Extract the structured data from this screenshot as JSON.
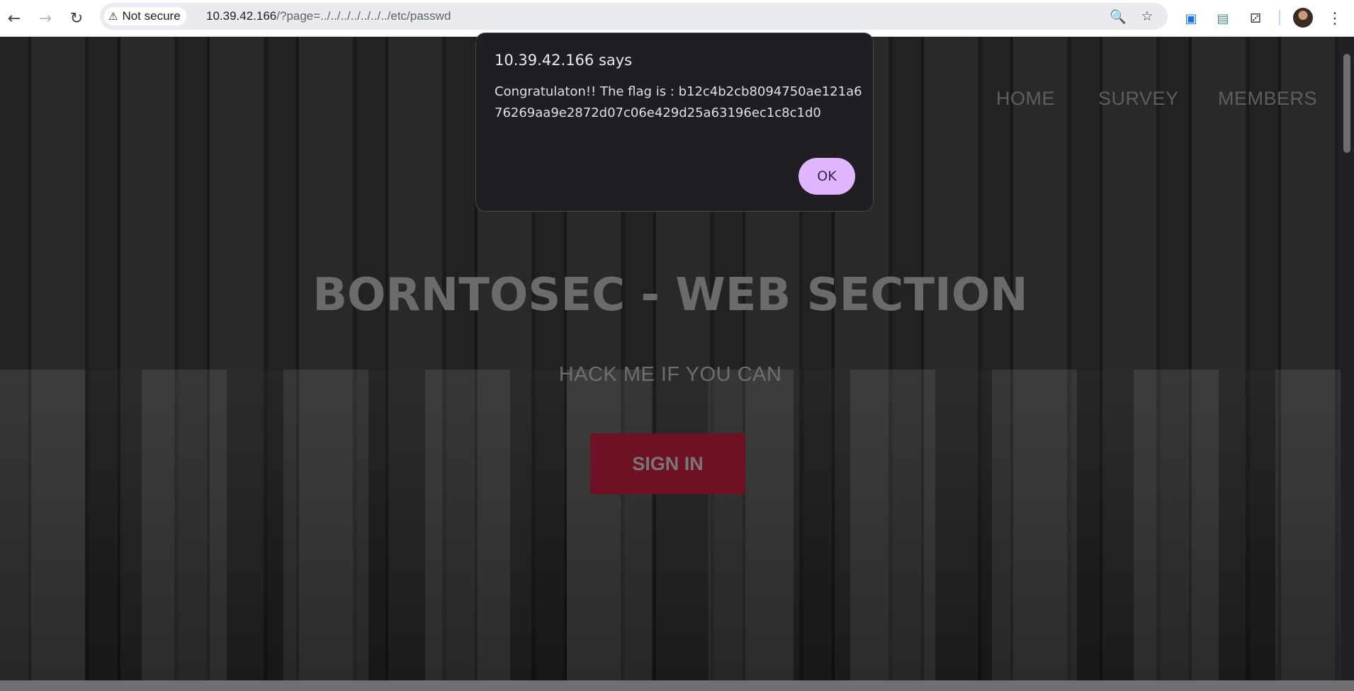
{
  "browser": {
    "security_label": "Not secure",
    "url_host": "10.39.42.166",
    "url_path": "/?page=../../../../../../../etc/passwd"
  },
  "nav": {
    "home": "HOME",
    "survey": "SURVEY",
    "members": "MEMBERS"
  },
  "hero": {
    "title": "BORNTOSEC - WEB SECTION",
    "subtitle": "HACK ME IF YOU CAN",
    "signin": "SIGN IN"
  },
  "dialog": {
    "title": "10.39.42.166 says",
    "message": "Congratulaton!! The flag is : b12c4b2cb8094750ae121a676269aa9e2872d07c06e429d25a63196ec1c8c1d0",
    "ok_label": "OK"
  },
  "colors": {
    "dialog_bg": "#201e22",
    "ok_button": "#e0b6ff",
    "signin_button": "#6f1124"
  }
}
